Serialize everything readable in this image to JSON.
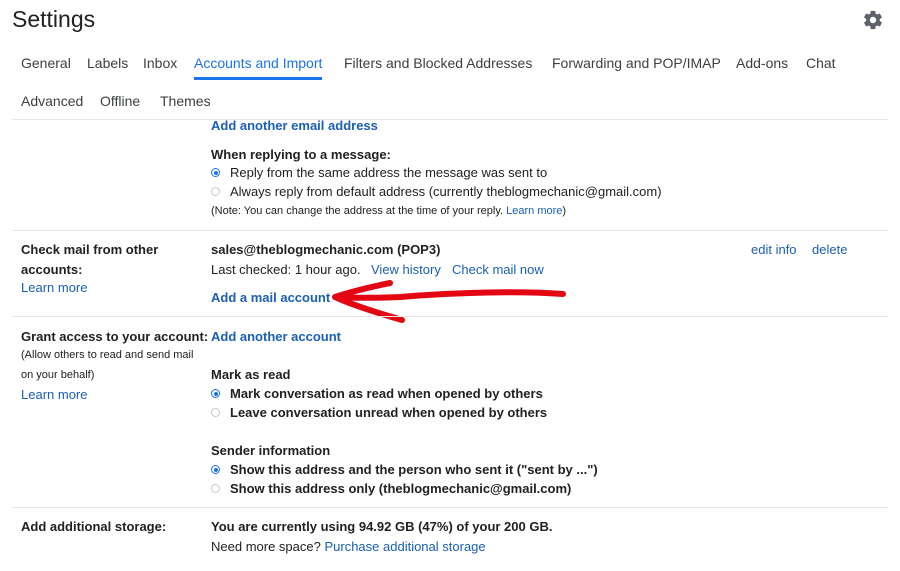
{
  "header": {
    "title": "Settings",
    "settings_icon": "gear-icon"
  },
  "tabs": [
    {
      "label": "General"
    },
    {
      "label": "Labels"
    },
    {
      "label": "Inbox"
    },
    {
      "label": "Accounts and Import",
      "active": true
    },
    {
      "label": "Filters and Blocked Addresses"
    },
    {
      "label": "Forwarding and POP/IMAP"
    },
    {
      "label": "Add-ons"
    },
    {
      "label": "Chat"
    },
    {
      "label": "Advanced"
    },
    {
      "label": "Offline"
    },
    {
      "label": "Themes"
    }
  ],
  "send_mail": {
    "add_email_link": "Add another email address",
    "reply_heading": "When replying to a message:",
    "reply_options": [
      {
        "label": "Reply from the same address the message was sent to",
        "selected": true
      },
      {
        "label": "Always reply from default address (currently theblogmechanic@gmail.com)",
        "selected": false
      }
    ],
    "note": "(Note: You can change the address at the time of your reply.",
    "note_link": "Learn more",
    "note_end": ")"
  },
  "check_mail": {
    "label_line1": "Check mail from other",
    "label_line2": "accounts:",
    "learn_more": "Learn more",
    "account": "sales@theblogmechanic.com (POP3)",
    "last_checked": "Last checked: 1 hour ago.",
    "view_history": "View history",
    "check_now": "Check mail now",
    "add_account": "Add a mail account",
    "edit_info": "edit info",
    "delete": "delete"
  },
  "grant_access": {
    "label": "Grant access to your account:",
    "desc_line1": "(Allow others to read and send mail",
    "desc_line2": "on your behalf)",
    "learn_more": "Learn more",
    "add_account": "Add another account",
    "mark_heading": "Mark as read",
    "mark_options": [
      {
        "label": "Mark conversation as read when opened by others",
        "selected": true
      },
      {
        "label": "Leave conversation unread when opened by others",
        "selected": false
      }
    ],
    "sender_heading": "Sender information",
    "sender_options": [
      {
        "label": "Show this address and the person who sent it (\"sent by ...\")",
        "selected": true
      },
      {
        "label": "Show this address only (theblogmechanic@gmail.com)",
        "selected": false
      }
    ]
  },
  "storage": {
    "label": "Add additional storage:",
    "usage": "You are currently using 94.92 GB (47%) of your 200 GB.",
    "need_more": "Need more space?",
    "purchase_link": "Purchase additional storage"
  },
  "colors": {
    "accent": "#1a73e8",
    "link": "#1a5fb4",
    "annotation_arrow": "#e30613"
  }
}
